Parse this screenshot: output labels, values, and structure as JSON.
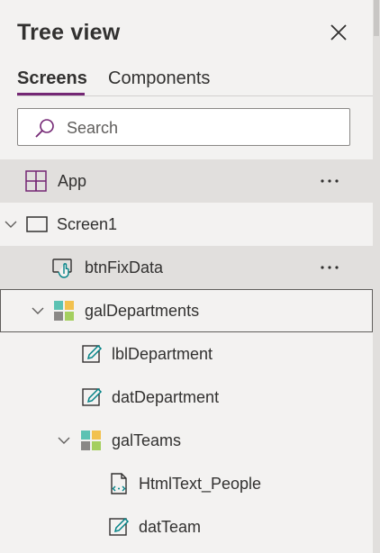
{
  "panel": {
    "title": "Tree view",
    "tabs": [
      {
        "label": "Screens",
        "active": true
      },
      {
        "label": "Components",
        "active": false
      }
    ],
    "search": {
      "placeholder": "Search",
      "value": ""
    },
    "accent_color": "#742774",
    "icon_color": "#742774"
  },
  "tree": [
    {
      "label": "App",
      "icon": "app-icon",
      "more": "···"
    },
    {
      "label": "Screen1",
      "icon": "screen-icon",
      "expanded": true
    },
    {
      "label": "btnFixData",
      "icon": "button-icon",
      "more": "···"
    },
    {
      "label": "galDepartments",
      "icon": "gallery-icon",
      "expanded": true
    },
    {
      "label": "lblDepartment",
      "icon": "edit-icon"
    },
    {
      "label": "datDepartment",
      "icon": "edit-icon"
    },
    {
      "label": "galTeams",
      "icon": "gallery-icon",
      "expanded": true
    },
    {
      "label": "HtmlText_People",
      "icon": "html-text-icon"
    },
    {
      "label": "datTeam",
      "icon": "edit-icon"
    }
  ]
}
